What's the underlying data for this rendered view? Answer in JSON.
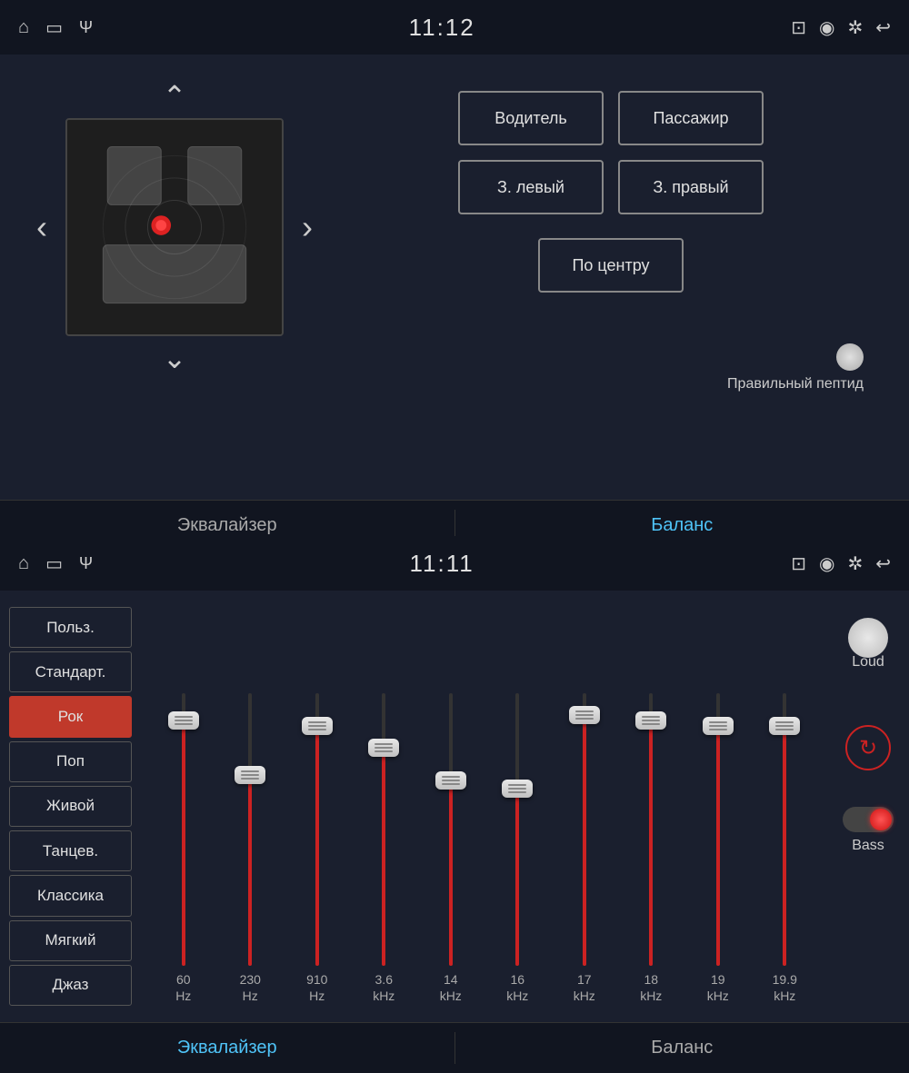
{
  "topPanel": {
    "statusBar": {
      "time": "11:12"
    },
    "tabs": {
      "equalizer": "Эквалайзер",
      "balance": "Баланс"
    },
    "balanceButtons": {
      "driver": "Водитель",
      "passenger": "Пассажир",
      "rearLeft": "З. левый",
      "rearRight": "З. правый",
      "center": "По центру",
      "statusLabel": "Правильный пептид"
    }
  },
  "bottomPanel": {
    "statusBar": {
      "time": "11:11"
    },
    "presets": [
      {
        "id": "user",
        "label": "Польз.",
        "active": false
      },
      {
        "id": "standard",
        "label": "Стандарт.",
        "active": false
      },
      {
        "id": "rock",
        "label": "Рок",
        "active": true
      },
      {
        "id": "pop",
        "label": "Поп",
        "active": false
      },
      {
        "id": "live",
        "label": "Живой",
        "active": false
      },
      {
        "id": "dance",
        "label": "Танцев.",
        "active": false
      },
      {
        "id": "classic",
        "label": "Классика",
        "active": false
      },
      {
        "id": "soft",
        "label": "Мягкий",
        "active": false
      },
      {
        "id": "jazz",
        "label": "Джаз",
        "active": false
      }
    ],
    "bands": [
      {
        "freq": "60",
        "unit": "Hz",
        "fillPct": 90
      },
      {
        "freq": "230",
        "unit": "Hz",
        "fillPct": 70
      },
      {
        "freq": "910",
        "unit": "Hz",
        "fillPct": 88
      },
      {
        "freq": "3.6",
        "unit": "kHz",
        "fillPct": 80
      },
      {
        "freq": "14",
        "unit": "kHz",
        "fillPct": 68
      },
      {
        "freq": "16",
        "unit": "kHz",
        "fillPct": 65
      },
      {
        "freq": "17",
        "unit": "kHz",
        "fillPct": 92
      },
      {
        "freq": "18",
        "unit": "kHz",
        "fillPct": 90
      },
      {
        "freq": "19",
        "unit": "kHz",
        "fillPct": 88
      },
      {
        "freq": "19.9",
        "unit": "kHz",
        "fillPct": 88
      }
    ],
    "controls": {
      "loudLabel": "Loud",
      "bassLabel": "Bass"
    },
    "tabs": {
      "equalizer": "Эквалайзер",
      "balance": "Баланс"
    }
  }
}
